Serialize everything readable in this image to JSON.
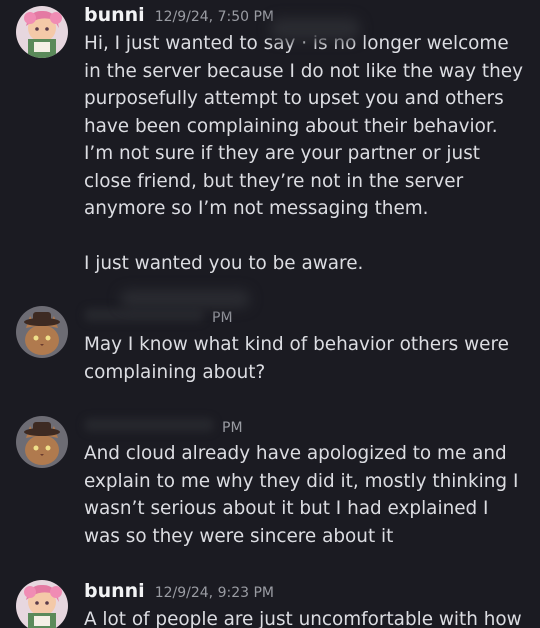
{
  "messages": [
    {
      "username": "bunni",
      "timestamp": "12/9/24, 7:50 PM",
      "paragraphs": [
        "Hi, I just wanted to say · is no longer welcome in the server because I do not like the way they purposefully attempt to upset you and others have been complaining about their behavior. I’m not sure if they are your partner or just close friend, but they’re not in the server anymore so I’m not messaging them.",
        "I just wanted you to be aware."
      ]
    },
    {
      "username": "",
      "timestamp": "PM",
      "paragraphs": [
        "May I know what kind of behavior others were complaining about?"
      ]
    },
    {
      "username": "",
      "timestamp": "PM",
      "paragraphs": [
        "And cloud already have apologized to me and explain to me why they did it, mostly thinking I wasn’t serious about it but I had explained I was so they were sincere about it"
      ]
    },
    {
      "username": "bunni",
      "timestamp": "12/9/24, 9:23 PM",
      "paragraphs": [
        "A lot of people are just uncomfortable with how"
      ]
    }
  ],
  "colors": {
    "background": "#1b1b22",
    "text": "#dcdde2",
    "username": "#f2f3f5",
    "timestamp": "#9a9ca3"
  },
  "icons": {
    "avatar_bunni": "anime-girl-avatar",
    "avatar_other": "cat-with-hat-avatar"
  }
}
